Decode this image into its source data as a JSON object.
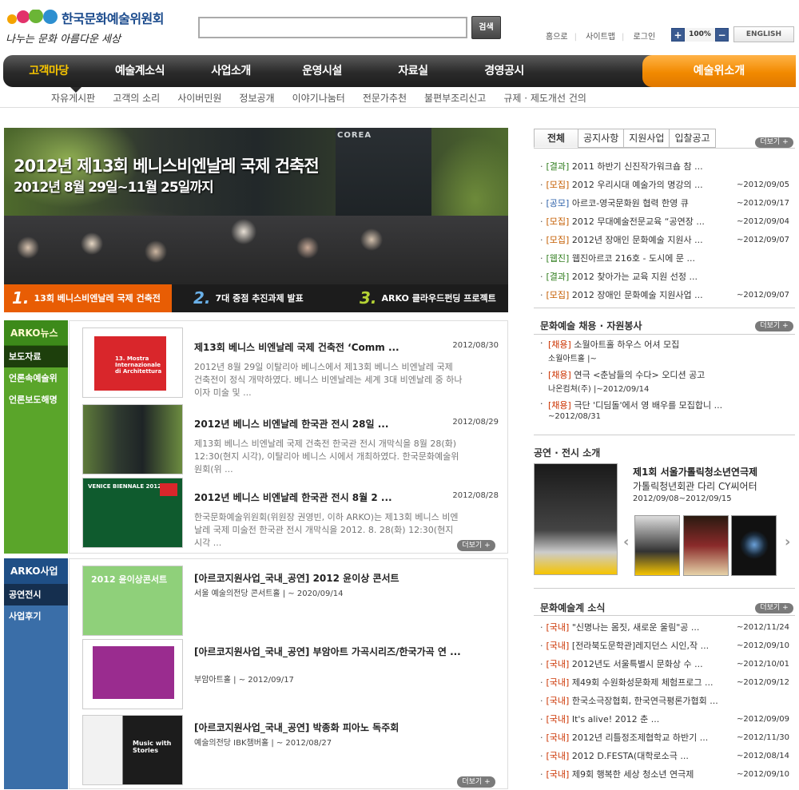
{
  "header": {
    "logo_title": "한국문화예술위원회",
    "logo_slogan": "나누는 문화 아름다운 세상",
    "search_button": "검색",
    "search_value": "",
    "utility": [
      "홈으로",
      "사이트맵",
      "로그인"
    ],
    "zoom_in": "+",
    "zoom_level": "100%",
    "zoom_out": "−",
    "english": "ENGLISH"
  },
  "nav": {
    "items": [
      "고객마당",
      "예술계소식",
      "사업소개",
      "운영시설",
      "자료실",
      "경영공시"
    ],
    "art_intro": "예술위소개",
    "sub_items": [
      "자유게시판",
      "고객의 소리",
      "사이버민원",
      "정보공개",
      "이야기나눔터",
      "전문가추천",
      "불편부조리신고",
      "규제 · 제도개선 건의"
    ]
  },
  "banner": {
    "headline": "2012년 제13회 베니스비엔날레 국제 건축전",
    "dates": "2012년 8월 29일~11월 25일까지",
    "wall_label": "COREA",
    "tabs": [
      {
        "num": "1.",
        "label": "13회 베니스비엔날레 국제 건축전"
      },
      {
        "num": "2.",
        "label": "7대 중점 추진과제 발표"
      },
      {
        "num": "3.",
        "label": "ARKO 클라우드펀딩 프로젝트"
      }
    ]
  },
  "news_side": {
    "title": "ARKO뉴스",
    "items": [
      "보도자료",
      "언론속예술위",
      "언론보도해명"
    ]
  },
  "news": [
    {
      "title": "제13회 베니스 비엔날레 국제 건축전 ‘Comm ...",
      "date": "2012/08/30",
      "body": "2012년 8월 29일 이탈리아 베니스에서 제13회 베니스 비엔날레 국제 건축전이 정식 개막하였다. 베니스 비엔날레는 세계 3대 비엔날레 중 하나이자 미술 및 ...",
      "thumb_text": "13. Mostra Internazionale di Architettura"
    },
    {
      "title": "2012년 베니스 비엔날레 한국관 전시 28일 ...",
      "date": "2012/08/29",
      "body": "제13회 베니스 비엔날레 국제 건축전 한국관 전시 개막식을 8월 28(화) 12:30(현지 시각), 이탈리아 베니스 시에서 개최하였다. 한국문화예술위원회(위 ..."
    },
    {
      "title": "2012년 베니스 비엔날레 한국관 전시 8월 2 ...",
      "date": "2012/08/28",
      "body": "한국문화예술위원회(위원장 권영빈, 이하 ARKO)는 제13회 베니스 비엔날레 국제 미술전 한국관 전시 개막식을 2012. 8. 28(화) 12:30(현지 시각 ...",
      "thumb_text": "VENICE BIENNALE 2012"
    }
  ],
  "more_label": "더보기 +",
  "biz_side": {
    "title": "ARKO사업",
    "items": [
      "공연전시",
      "사업후기"
    ]
  },
  "biz": [
    {
      "title": "[아르코지원사업_국내_공연]  2012 윤이상 콘서트",
      "sub": "서울 예술의전당 콘서트홀  |  ~ 2020/09/14",
      "thumb_text": "2012 윤이상콘서트"
    },
    {
      "title": "[아르코지원사업_국내_공연]  부암아트 가곡시리즈/한국가곡 연 ...",
      "sub": "부암아트홀  |  ~ 2012/09/17"
    },
    {
      "title": "[아르코지원사업_국내_공연]  박종화 피아노 독주회",
      "sub": "예술의전당 IBK챔버홀  |  ~ 2012/08/27",
      "thumb_text": "Music with Stories"
    }
  ],
  "notice": {
    "tabs": [
      "전체",
      "공지사항",
      "지원사업",
      "입찰공고"
    ],
    "items": [
      {
        "cat": "[결과]",
        "text": "2011 하반기 신진작가워크숍 참 ...",
        "date": ""
      },
      {
        "cat": "[모집]",
        "text": "2012 우리시대 예술가의 명강의 ...",
        "date": "~2012/09/05"
      },
      {
        "cat": "[공모]",
        "text": "아르코-영국문화원 협력 한영 큐",
        "date": "~2012/09/17"
      },
      {
        "cat": "[모집]",
        "text": "2012 무대예술전문교육 “공연장 ...",
        "date": "~2012/09/04"
      },
      {
        "cat": "[모집]",
        "text": "2012년 장애인 문화예술 지원사 ...",
        "date": "~2012/09/07"
      },
      {
        "cat": "[웹진]",
        "text": "웹진아르코 216호 - 도시에 문 ...",
        "date": ""
      },
      {
        "cat": "[결과]",
        "text": "2012 찾아가는 교육 지원 선정 ...",
        "date": ""
      },
      {
        "cat": "[모집]",
        "text": "2012 장애인 문화예술 지원사업 ...",
        "date": "~2012/09/07"
      }
    ]
  },
  "jobs": {
    "title": "문화예술 채용 · 자원봉사",
    "items": [
      {
        "cat": "[채용]",
        "text": "소월아트홀 하우스 어셔 모집",
        "line2": "소월아트홀 |~"
      },
      {
        "cat": "[채용]",
        "text": "연극 <춘남들의 수다> 오디션 공고",
        "line2": "나온컴쳐(주) |~2012/09/14"
      },
      {
        "cat": "[채용]",
        "text": "극단 '디딤돌'에서 영 배우를 모집합니 ...",
        "line2": "~2012/08/31"
      }
    ]
  },
  "show": {
    "section_title": "공연 · 전시 소개",
    "title": "제1회 서울가톨릭청소년연극제",
    "venue": "가톨릭청년회관 다리 CY씨어터",
    "date": "2012/09/08~2012/09/15",
    "prev": "‹",
    "next": "›"
  },
  "culture": {
    "title": "문화예술계 소식",
    "items": [
      {
        "cat": "[국내]",
        "text": "\"신명나는 몸짓, 새로운 울림\"공 ...",
        "date": "~2012/11/24"
      },
      {
        "cat": "[국내]",
        "text": "[전라북도문학관]레지던스 시인,작 ...",
        "date": "~2012/09/10"
      },
      {
        "cat": "[국내]",
        "text": "2012년도 서울특별시 문화상 수 ...",
        "date": "~2012/10/01"
      },
      {
        "cat": "[국내]",
        "text": "제49회 수원화성문화제 체험프로그 ...",
        "date": "~2012/09/12"
      },
      {
        "cat": "[국내]",
        "text": "한국소극장협회, 한국연극평론가협회 ...",
        "date": ""
      },
      {
        "cat": "[국내]",
        "text": "It's alive! 2012 춘 ...",
        "date": "~2012/09/09"
      },
      {
        "cat": "[국내]",
        "text": "2012년 리틀정조제협학교 하반기 ...",
        "date": "~2012/11/30"
      },
      {
        "cat": "[국내]",
        "text": "2012 D.FESTA(대학로소극 ...",
        "date": "~2012/08/14"
      },
      {
        "cat": "[국내]",
        "text": "제9회 행복한 세상 청소년 연극제",
        "date": "~2012/09/10"
      }
    ]
  }
}
